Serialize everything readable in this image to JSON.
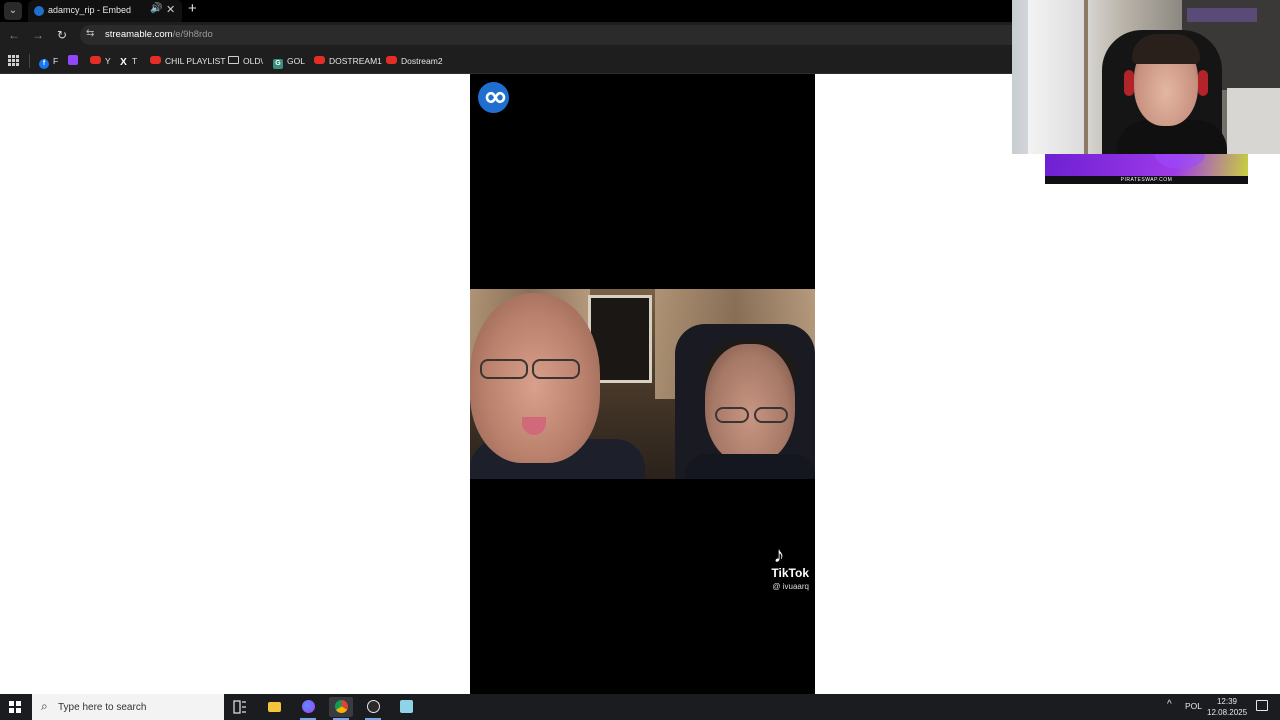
{
  "browser": {
    "tab": {
      "title": "adamcy_rip - Embed",
      "close_glyph": "✕",
      "audio_glyph": "🔊"
    },
    "new_tab_glyph": "+",
    "address": {
      "host": "streamable.com",
      "path": "/e/9h8rdo"
    },
    "nav": {
      "back_glyph": "←",
      "forward_glyph": "→",
      "reload_glyph": "↻",
      "tab_search_glyph": "⌄",
      "site_info_glyph": "⇆"
    },
    "bookmarks": [
      {
        "label": "F",
        "icon": "facebook-icon"
      },
      {
        "label": "",
        "icon": "twitch-icon"
      },
      {
        "label": "Y",
        "icon": "youtube-icon"
      },
      {
        "label": "T",
        "icon": "x-icon"
      },
      {
        "label": "CHIL PLAYLIST",
        "icon": "youtube-icon"
      },
      {
        "label": "OLD\\",
        "icon": "folder-icon"
      },
      {
        "label": "GOL",
        "icon": "gol-icon"
      },
      {
        "label": "DOSTREAM1",
        "icon": "youtube-icon"
      },
      {
        "label": "Dostream2",
        "icon": "youtube-icon"
      }
    ]
  },
  "video": {
    "tiktok_note": "♪",
    "tiktok_brand": "TikTok",
    "tiktok_handle": "@ ivuaarq"
  },
  "ad": {
    "domain": "PIRATESWAP.COM"
  },
  "taskbar": {
    "search_placeholder": "Type here to search",
    "search_glyph": "⌕",
    "tray_chevron": "^",
    "language": "POL",
    "time": "12:39",
    "date": "12.08.2025"
  },
  "colors": {
    "streamable_blue": "#1f6fd1",
    "ad_purple": "#8a2fe0",
    "taskbar_bg": "#1b1c20"
  }
}
